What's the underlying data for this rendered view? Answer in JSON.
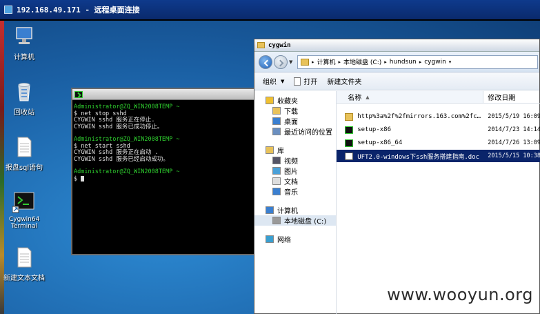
{
  "remote_desktop": {
    "title": "192.168.49.171 - 远程桌面连接"
  },
  "desktop_icons": [
    {
      "label": "计算机",
      "icon": "computer-icon"
    },
    {
      "label": "回收站",
      "icon": "recycle-bin-icon"
    },
    {
      "label": "报盘sql语句",
      "icon": "text-file-icon"
    },
    {
      "label": "Cygwin64 Terminal",
      "icon": "terminal-icon"
    },
    {
      "label": "新建文本文档",
      "icon": "text-file-icon"
    }
  ],
  "terminal": {
    "lines": [
      {
        "text": "Administrator@ZQ_WIN2008TEMP ~",
        "prompt": true
      },
      {
        "text": "$ net stop sshd",
        "prompt": false
      },
      {
        "text": "CYGWIN sshd 服务正在停止.",
        "prompt": false
      },
      {
        "text": "CYGWIN sshd 服务已成功停止。",
        "prompt": false
      },
      {
        "text": "",
        "prompt": false
      },
      {
        "text": "Administrator@ZQ_WIN2008TEMP ~",
        "prompt": true
      },
      {
        "text": "$ net start sshd",
        "prompt": false
      },
      {
        "text": "CYGWIN sshd 服务正在启动 .",
        "prompt": false
      },
      {
        "text": "CYGWIN sshd 服务已经启动成功。",
        "prompt": false
      },
      {
        "text": "",
        "prompt": false
      },
      {
        "text": "Administrator@ZQ_WIN2008TEMP ~",
        "prompt": true
      },
      {
        "text": "$ ",
        "prompt": false
      }
    ]
  },
  "explorer": {
    "title": "cygwin",
    "breadcrumb": [
      "计算机",
      "本地磁盘 (C:)",
      "hundsun",
      "cygwin"
    ],
    "toolbar": {
      "organize": "组织",
      "open": "打开",
      "new_folder": "新建文件夹"
    },
    "nav": [
      {
        "label": "收藏夹",
        "level": 1,
        "icon": "star-icon"
      },
      {
        "label": "下载",
        "level": 2,
        "icon": "download-folder-icon"
      },
      {
        "label": "桌面",
        "level": 2,
        "icon": "desktop-icon"
      },
      {
        "label": "最近访问的位置",
        "level": 2,
        "icon": "recent-places-icon"
      },
      {
        "label": "",
        "level": 0,
        "icon": ""
      },
      {
        "label": "库",
        "level": 1,
        "icon": "library-icon"
      },
      {
        "label": "视频",
        "level": 2,
        "icon": "video-icon"
      },
      {
        "label": "图片",
        "level": 2,
        "icon": "picture-icon"
      },
      {
        "label": "文档",
        "level": 2,
        "icon": "document-icon"
      },
      {
        "label": "音乐",
        "level": 2,
        "icon": "music-icon"
      },
      {
        "label": "",
        "level": 0,
        "icon": ""
      },
      {
        "label": "计算机",
        "level": 1,
        "icon": "computer-icon"
      },
      {
        "label": "本地磁盘 (C:)",
        "level": 2,
        "icon": "drive-icon",
        "selected": true
      },
      {
        "label": "",
        "level": 0,
        "icon": ""
      },
      {
        "label": "网络",
        "level": 1,
        "icon": "network-icon"
      }
    ],
    "columns": {
      "name": "名称",
      "date": "修改日期"
    },
    "files": [
      {
        "name": "http%3a%2f%2fmirrors.163.com%2fcyg...",
        "date": "2015/5/19 16:09",
        "type": "folder",
        "selected": false
      },
      {
        "name": "setup-x86",
        "date": "2014/7/23 14:14",
        "type": "exe",
        "selected": false
      },
      {
        "name": "setup-x86_64",
        "date": "2014/7/26 13:09",
        "type": "exe",
        "selected": false
      },
      {
        "name": "UFT2.0-windows下ssh服务搭建指南.doc",
        "date": "2015/5/15 10:38",
        "type": "doc",
        "selected": true
      }
    ]
  },
  "watermark": "www.wooyun.org",
  "colors": {
    "terminal_prompt": "#2fcf2f",
    "selection": "#0a246a",
    "desktop": "#1f6fb0"
  }
}
